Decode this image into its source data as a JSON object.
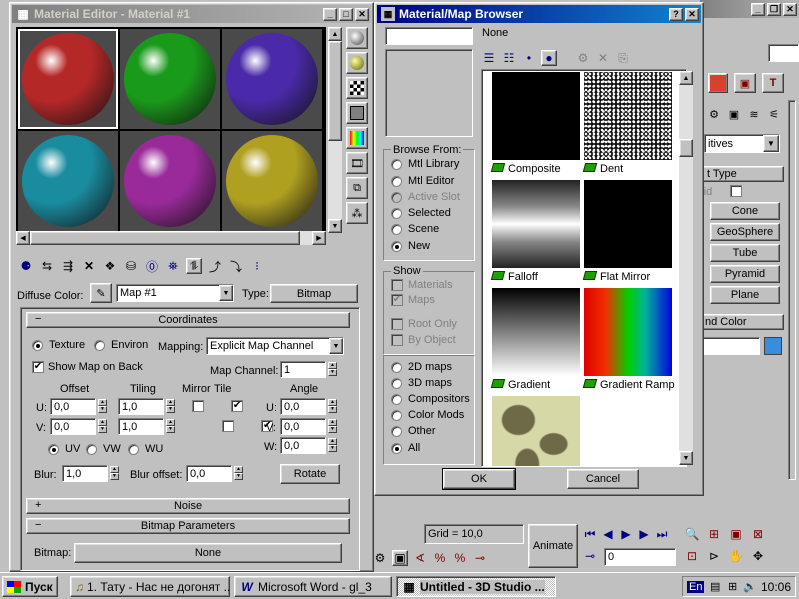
{
  "material_editor": {
    "title": "Material Editor - Material #1",
    "diffuse_label": "Diffuse Color:",
    "map_name": "Map #1",
    "type_label": "Type:",
    "type_value": "Bitmap",
    "coordinates": {
      "header": "Coordinates",
      "texture": "Texture",
      "environ": "Environ",
      "mapping_label": "Mapping:",
      "mapping_value": "Explicit Map Channel",
      "show_map": "Show Map on Back",
      "map_channel_label": "Map Channel:",
      "map_channel_value": "1",
      "offset": "Offset",
      "tiling": "Tiling",
      "mirror": "Mirror",
      "tile": "Tile",
      "angle": "Angle",
      "u": "U:",
      "v": "V:",
      "w": "W:",
      "u_offset": "0,0",
      "v_offset": "0,0",
      "u_tiling": "1,0",
      "v_tiling": "1,0",
      "u_angle": "0,0",
      "v_angle": "0,0",
      "w_angle": "0,0",
      "uv": "UV",
      "vw": "VW",
      "wu": "WU",
      "blur_label": "Blur:",
      "blur_value": "1,0",
      "blur_offset_label": "Blur offset:",
      "blur_offset_value": "0,0",
      "rotate": "Rotate"
    },
    "noise_header": "Noise",
    "bitmap_header": "Bitmap Parameters",
    "bitmap_label": "Bitmap:",
    "bitmap_value": "None",
    "plus": "+",
    "minus": "−",
    "spheres": [
      "#b52828",
      "#1a9a1a",
      "#4a2aa8",
      "#1a8ca0",
      "#9a2a9a",
      "#b0a020"
    ]
  },
  "browser": {
    "title": "Material/Map Browser",
    "name_value": "None",
    "browse_from": "Browse From:",
    "browse_options": [
      "Mtl Library",
      "Mtl Editor",
      "Active Slot",
      "Selected",
      "Scene",
      "New"
    ],
    "show": "Show",
    "show_options": [
      "Materials",
      "Maps"
    ],
    "root_only": "Root Only",
    "by_object": "By Object",
    "filter_options": [
      "2D maps",
      "3D maps",
      "Compositors",
      "Color Mods",
      "Other",
      "All"
    ],
    "maps": [
      "Composite",
      "Dent",
      "Falloff",
      "Flat Mirror",
      "Gradient",
      "Gradient Ramp"
    ],
    "ok": "OK",
    "cancel": "Cancel"
  },
  "right_panel": {
    "dropdown": "itives",
    "section_type": "t Type",
    "grid_label": "rid",
    "buttons": [
      "Cone",
      "GeoSphere",
      "Tube",
      "Pyramid",
      "Plane"
    ],
    "color_section": "nd Color"
  },
  "status": {
    "grid": "Grid = 10,0",
    "animate": "Animate",
    "frame": "0"
  },
  "taskbar": {
    "start": "Пуск",
    "tasks": [
      "1. Тату - Нас не догонят ...",
      "Microsoft Word - gl_3",
      "Untitled  - 3D Studio ..."
    ],
    "lang": "En",
    "clock": "10:06"
  }
}
